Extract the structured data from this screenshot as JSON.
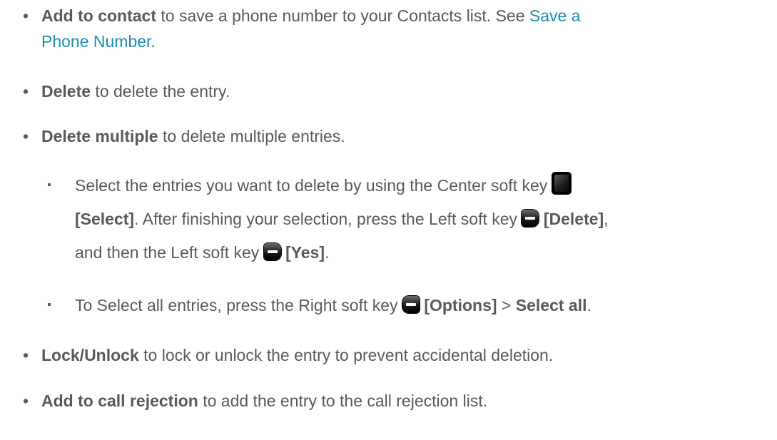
{
  "bullets": {
    "l1_bullet": "•",
    "l2_bullet": "▪"
  },
  "item_add_contact": {
    "bold": "Add to contact",
    "text": " to save a phone number to your Contacts list. See ",
    "link_line1": "Save a",
    "link_line2": "Phone Number",
    "after_link": "."
  },
  "item_delete": {
    "bold": "Delete",
    "text": " to delete the entry."
  },
  "item_delete_multiple": {
    "bold": "Delete multiple",
    "text": " to delete multiple entries."
  },
  "sub_select": {
    "text1": "Select the entries you want to delete by using the Center soft key ",
    "bold_select": "[Select]",
    "text2": ". After finishing your selection, press the Left soft key ",
    "bold_delete": "[Delete]",
    "text3": ",",
    "text4": "and then the Left soft key ",
    "bold_yes": "[Yes]",
    "text5": "."
  },
  "sub_select_all": {
    "text1": "To Select all entries, press the Right soft key ",
    "bold_options": "[Options]",
    "text2": " > ",
    "bold_select_all": "Select all",
    "text3": "."
  },
  "item_lock": {
    "bold": "Lock/Unlock",
    "text": " to lock or unlock the entry to prevent accidental deletion."
  },
  "item_call_rejection": {
    "bold": "Add to call rejection",
    "text": " to add the entry to the call rejection list."
  },
  "icons": {
    "center_key": "center-soft-key-icon",
    "left_key": "left-soft-key-icon",
    "right_key": "right-soft-key-icon"
  }
}
